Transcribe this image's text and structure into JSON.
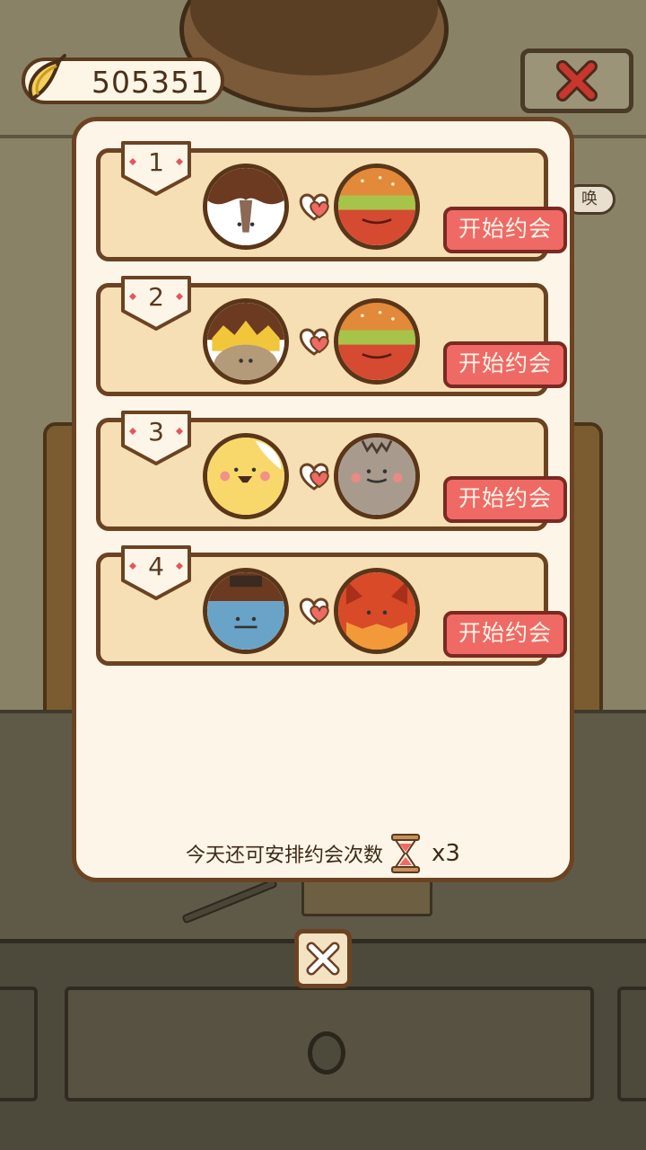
{
  "currency": {
    "icon": "banana-icon",
    "value": "505351"
  },
  "top_close": {
    "icon": "close-x-icon"
  },
  "side_badge": {
    "label": "唤"
  },
  "dates": [
    {
      "number": "1",
      "left": "cow-character",
      "right": "burger-character",
      "button": "开始约会"
    },
    {
      "number": "2",
      "left": "pineapple-character",
      "right": "burger-character",
      "button": "开始约会"
    },
    {
      "number": "3",
      "left": "chick-character",
      "right": "gray-bat-character",
      "button": "开始约会"
    },
    {
      "number": "4",
      "left": "blue-hat-character",
      "right": "fox-character",
      "button": "开始约会"
    }
  ],
  "remaining": {
    "label": "今天还可安排约会次数",
    "icon": "hourglass-icon",
    "count": "x3"
  },
  "bottom_close": {
    "icon": "close-x-icon"
  },
  "colors": {
    "button_red": "#ef6a64",
    "panel": "#fdf5e8",
    "row": "#f6dfb4",
    "outline": "#6b4323"
  }
}
